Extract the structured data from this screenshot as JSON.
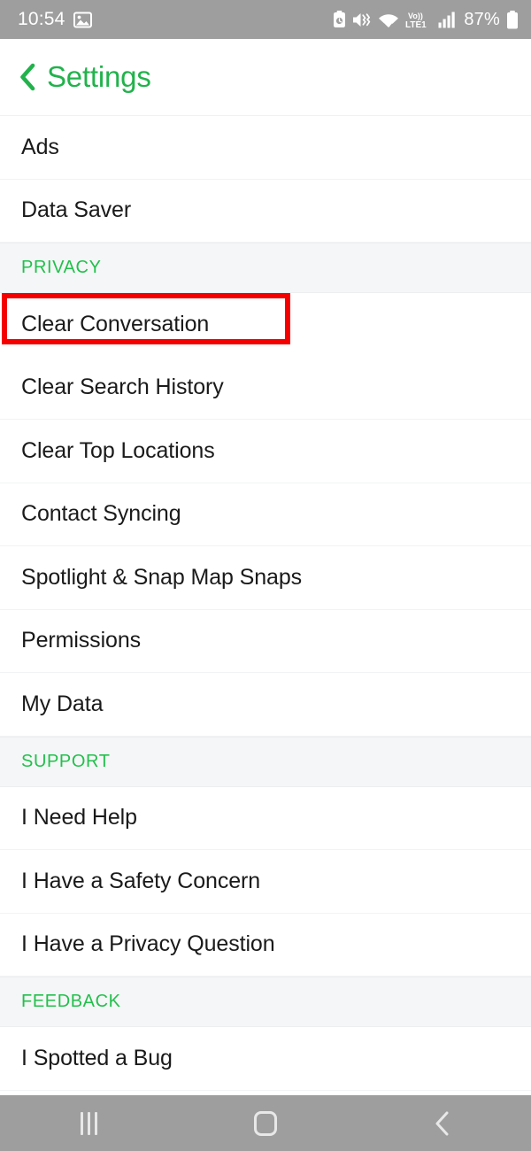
{
  "status_bar": {
    "time": "10:54",
    "battery_percent": "87%",
    "network_label": "LTE1",
    "volte_label": "Vo))",
    "icons": [
      "gallery-icon",
      "alarm-battery-icon",
      "mute-vibrate-icon",
      "wifi-icon",
      "volte-icon",
      "signal-bars-icon",
      "battery-icon"
    ],
    "background_color": "#9e9e9e",
    "foreground_color": "#ffffff"
  },
  "header": {
    "title": "Settings",
    "back_icon": "chevron-left-icon",
    "accent_color": "#22b24c"
  },
  "theme": {
    "accent_green": "#22b24c",
    "section_green": "#22c04c",
    "section_bg": "#f5f6f7",
    "row_text": "#1a1a1a",
    "highlight_red": "#f40000",
    "nav_bg": "#9e9e9e"
  },
  "list": [
    {
      "type": "row",
      "label": "Ads"
    },
    {
      "type": "row",
      "label": "Data Saver"
    },
    {
      "type": "section",
      "label": "PRIVACY"
    },
    {
      "type": "row",
      "label": "Clear Conversation",
      "highlighted": true
    },
    {
      "type": "row",
      "label": "Clear Search History"
    },
    {
      "type": "row",
      "label": "Clear Top Locations"
    },
    {
      "type": "row",
      "label": "Contact Syncing"
    },
    {
      "type": "row",
      "label": "Spotlight & Snap Map Snaps"
    },
    {
      "type": "row",
      "label": "Permissions"
    },
    {
      "type": "row",
      "label": "My Data"
    },
    {
      "type": "section",
      "label": "SUPPORT"
    },
    {
      "type": "row",
      "label": "I Need Help"
    },
    {
      "type": "row",
      "label": "I Have a Safety Concern"
    },
    {
      "type": "row",
      "label": "I Have a Privacy Question"
    },
    {
      "type": "section",
      "label": "FEEDBACK"
    },
    {
      "type": "row",
      "label": "I Spotted a Bug"
    }
  ],
  "nav_bar": {
    "recents_label": "recents-icon",
    "home_label": "home-icon",
    "back_label": "back-icon"
  }
}
